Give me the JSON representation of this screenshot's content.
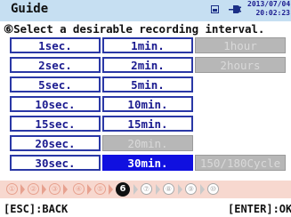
{
  "header": {
    "title": "Guide",
    "date": "2013/07/04",
    "time": "20:02:23"
  },
  "instruction": "⑥Select a desirable recording interval.",
  "intervals": {
    "col1": [
      "1sec.",
      "2sec.",
      "5sec.",
      "10sec.",
      "15sec.",
      "20sec.",
      "30sec."
    ],
    "col2": [
      "1min.",
      "2min.",
      "5min.",
      "10min.",
      "15min.",
      "20min.",
      "30min."
    ],
    "col3": [
      "1hour",
      "2hours",
      "150/180Cycle"
    ],
    "selected": "30min.",
    "disabled": [
      "20min.",
      "1hour",
      "2hours",
      "150/180Cycle"
    ]
  },
  "steps": {
    "labels": [
      "①",
      "②",
      "③",
      "④",
      "⑤",
      "6",
      "⑦",
      "⑧",
      "⑨",
      "⑩"
    ],
    "current": 6
  },
  "footer": {
    "back_label": "[ESC]:BACK",
    "ok_label": "[ENTER]:OK"
  },
  "colors": {
    "header_bg": "#c6dff2",
    "selected_bg": "#1010e0",
    "cell_border": "#2a38a6",
    "disabled_bg": "#b7b7b7",
    "step_bar_bg": "#f7d8cf"
  }
}
